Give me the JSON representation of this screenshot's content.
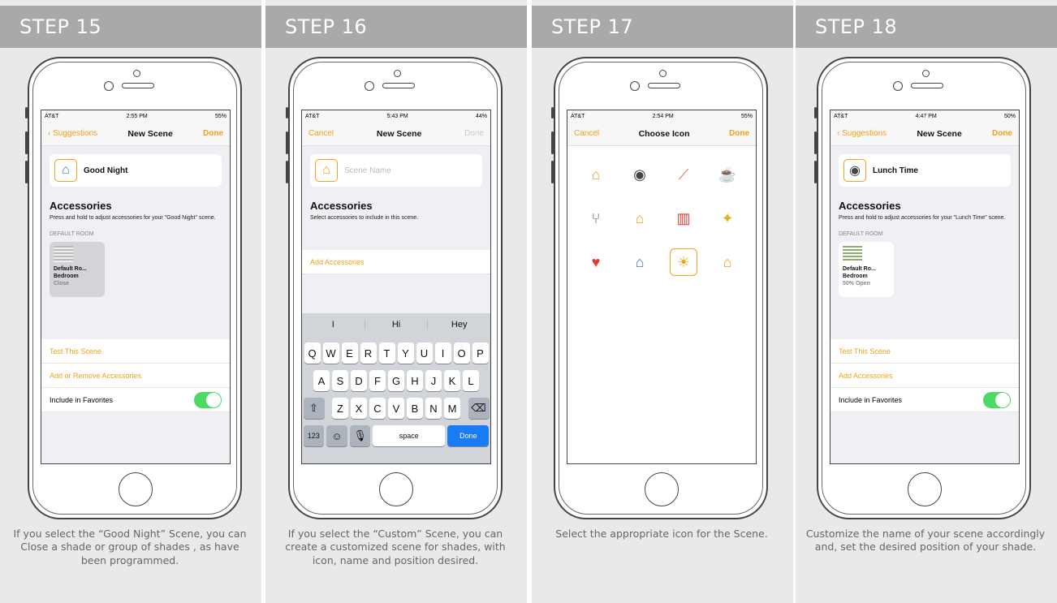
{
  "panels": [
    {
      "step": "STEP 15",
      "status": {
        "carrier": "AT&T",
        "time": "2:55 PM",
        "battery": "55%"
      },
      "nav": {
        "left": "Suggestions",
        "title": "New Scene",
        "right": "Done"
      },
      "scene_name": "Good Night",
      "icon": "moon-house-icon",
      "accessories_title": "Accessories",
      "accessories_sub": "Press and hold to adjust accessories for your \"Good Night\" scene.",
      "room": "DEFAULT ROOM",
      "tile": {
        "name": "Default Ro...",
        "room": "Bedroom",
        "state": "Close"
      },
      "rows": [
        "Test This Scene",
        "Add or Remove Accessories",
        "Include in Favorites"
      ],
      "caption": "If you select the “Good Night” Scene, you can Close a shade or group of shades , as have been programmed."
    },
    {
      "step": "STEP 16",
      "status": {
        "carrier": "AT&T",
        "time": "5:43 PM",
        "battery": "44%"
      },
      "nav": {
        "left": "Cancel",
        "title": "New Scene",
        "right": "Done"
      },
      "scene_placeholder": "Scene Name",
      "icon": "house-icon",
      "accessories_title": "Accessories",
      "accessories_sub": "Select accessories to include in this scene.",
      "add_row": "Add Accessories",
      "suggestions": [
        "I",
        "Hi",
        "Hey"
      ],
      "keys_row1": [
        "Q",
        "W",
        "E",
        "R",
        "T",
        "Y",
        "U",
        "I",
        "O",
        "P"
      ],
      "keys_row2": [
        "A",
        "S",
        "D",
        "F",
        "G",
        "H",
        "J",
        "K",
        "L"
      ],
      "keys_row3": [
        "Z",
        "X",
        "C",
        "V",
        "B",
        "N",
        "M"
      ],
      "key_123": "123",
      "key_space": "space",
      "key_done": "Done",
      "caption": "If you select the “Custom” Scene, you can create a customized scene for shades, with icon, name and position desired."
    },
    {
      "step": "STEP 17",
      "status": {
        "carrier": "AT&T",
        "time": "2:54 PM",
        "battery": "55%"
      },
      "nav": {
        "left": "Cancel",
        "title": "Choose Icon",
        "right": "Done"
      },
      "icons": [
        "house-person-icon",
        "magnifier-icon",
        "chair-icon",
        "mug-icon",
        "fork-knife-icon",
        "house-person-icon",
        "popcorn-icon",
        "party-icon",
        "heart-icon",
        "moon-house-icon",
        "sun-house-icon",
        "house-icon"
      ],
      "caption": "Select the appropriate icon for the Scene."
    },
    {
      "step": "STEP 18",
      "status": {
        "carrier": "AT&T",
        "time": "4:47 PM",
        "battery": "50%"
      },
      "nav": {
        "left": "Suggestions",
        "title": "New Scene",
        "right": "Done"
      },
      "scene_name": "Lunch Time",
      "icon": "magnifier-icon",
      "accessories_title": "Accessories",
      "accessories_sub": "Press and hold to adjust accessories for your \"Lunch Time\" scene.",
      "room": "DEFAULT ROOM",
      "tile": {
        "name": "Default Ro...",
        "room": "Bedroom",
        "state": "50% Open"
      },
      "rows": [
        "Test This Scene",
        "Add Accessories",
        "Include in Favorites"
      ],
      "caption": "Customize the name of your scene accordingly and, set the desired position of your shade."
    }
  ],
  "colors": {
    "accent": "#f0a21a",
    "toggle": "#4cd964",
    "band": "#a9a9aa"
  }
}
